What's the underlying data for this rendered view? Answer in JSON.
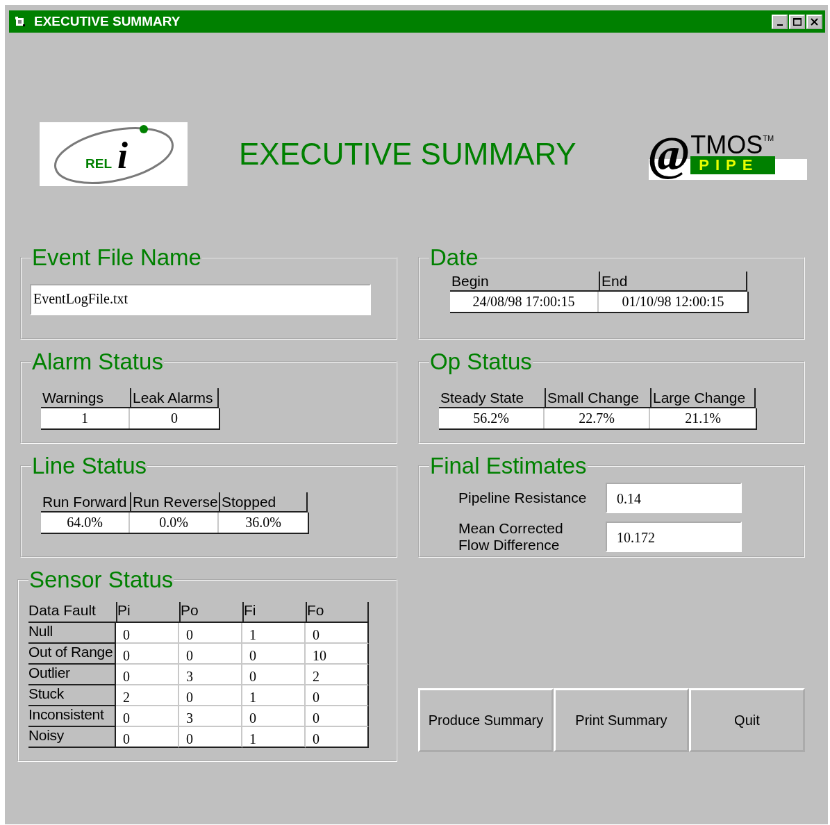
{
  "window": {
    "title": "EXECUTIVE SUMMARY"
  },
  "header": {
    "left_logo": {
      "text": "REL",
      "letter": "i"
    },
    "heading": "EXECUTIVE SUMMARY",
    "right_logo": {
      "symbol": "@",
      "name": "TMOS",
      "trademark": "TM",
      "product": "PIPE"
    }
  },
  "event_file": {
    "title": "Event File Name",
    "value": "EventLogFile.txt"
  },
  "date": {
    "title": "Date",
    "columns": [
      "Begin",
      "End"
    ],
    "values": [
      "24/08/98 17:00:15",
      "01/10/98 12:00:15"
    ]
  },
  "alarm_status": {
    "title": "Alarm Status",
    "columns": [
      "Warnings",
      "Leak Alarms"
    ],
    "values": [
      "1",
      "0"
    ]
  },
  "op_status": {
    "title": "Op Status",
    "columns": [
      "Steady State",
      "Small Change",
      "Large Change"
    ],
    "values": [
      "56.2%",
      "22.7%",
      "21.1%"
    ]
  },
  "line_status": {
    "title": "Line Status",
    "columns": [
      "Run Forward",
      "Run Reverse",
      "Stopped"
    ],
    "values": [
      "64.0%",
      "0.0%",
      "36.0%"
    ]
  },
  "final_estimates": {
    "title": "Final Estimates",
    "fields": [
      {
        "label": "Pipeline Resistance",
        "value": "0.14"
      },
      {
        "label": "Mean Corrected\nFlow Difference",
        "value": "10.172"
      }
    ]
  },
  "sensor_status": {
    "title": "Sensor Status",
    "columns": [
      "Data Fault",
      "Pi",
      "Po",
      "Fi",
      "Fo"
    ],
    "rows": [
      {
        "label": "Null",
        "values": [
          "0",
          "0",
          "1",
          "0"
        ]
      },
      {
        "label": "Out of Range",
        "values": [
          "0",
          "0",
          "0",
          "10"
        ]
      },
      {
        "label": "Outlier",
        "values": [
          "0",
          "3",
          "0",
          "2"
        ]
      },
      {
        "label": "Stuck",
        "values": [
          "2",
          "0",
          "1",
          "0"
        ]
      },
      {
        "label": "Inconsistent",
        "values": [
          "0",
          "3",
          "0",
          "0"
        ]
      },
      {
        "label": "Noisy",
        "values": [
          "0",
          "0",
          "1",
          "0"
        ]
      }
    ]
  },
  "buttons": [
    "Produce Summary",
    "Print Summary",
    "Quit"
  ]
}
